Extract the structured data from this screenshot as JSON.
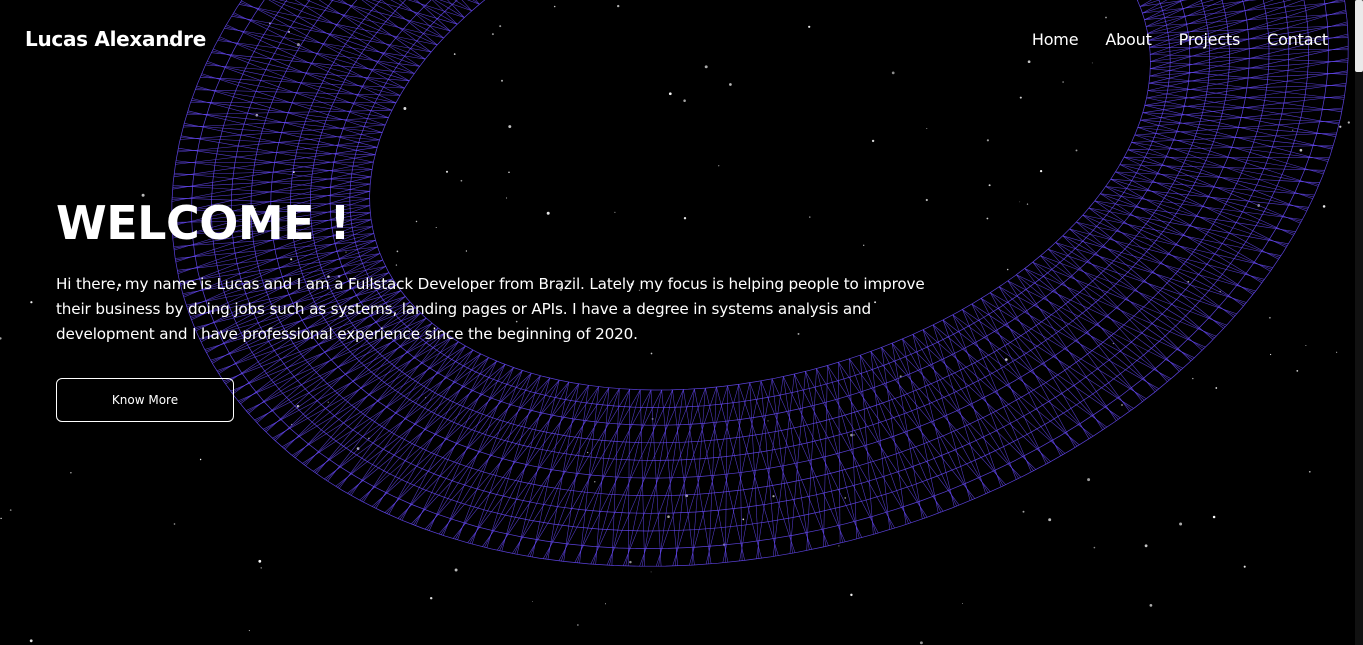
{
  "header": {
    "brand": "Lucas Alexandre",
    "nav": [
      "Home",
      "About",
      "Projects",
      "Contact"
    ]
  },
  "hero": {
    "title": "WELCOME !",
    "description": "Hi there, my name is Lucas and I am a Fullstack Developer from Brazil. Lately my focus is helping people to improve their business by doing jobs such as systems, landing pages or APIs. I have a degree in systems analysis and development and I have professional experience since the beginning of 2020.",
    "button": "Know More"
  },
  "colors": {
    "background": "#000000",
    "mesh": "#6a4cff",
    "text": "#ffffff"
  },
  "icons": [
    "wireframe-ring-graphic",
    "star-particles"
  ]
}
